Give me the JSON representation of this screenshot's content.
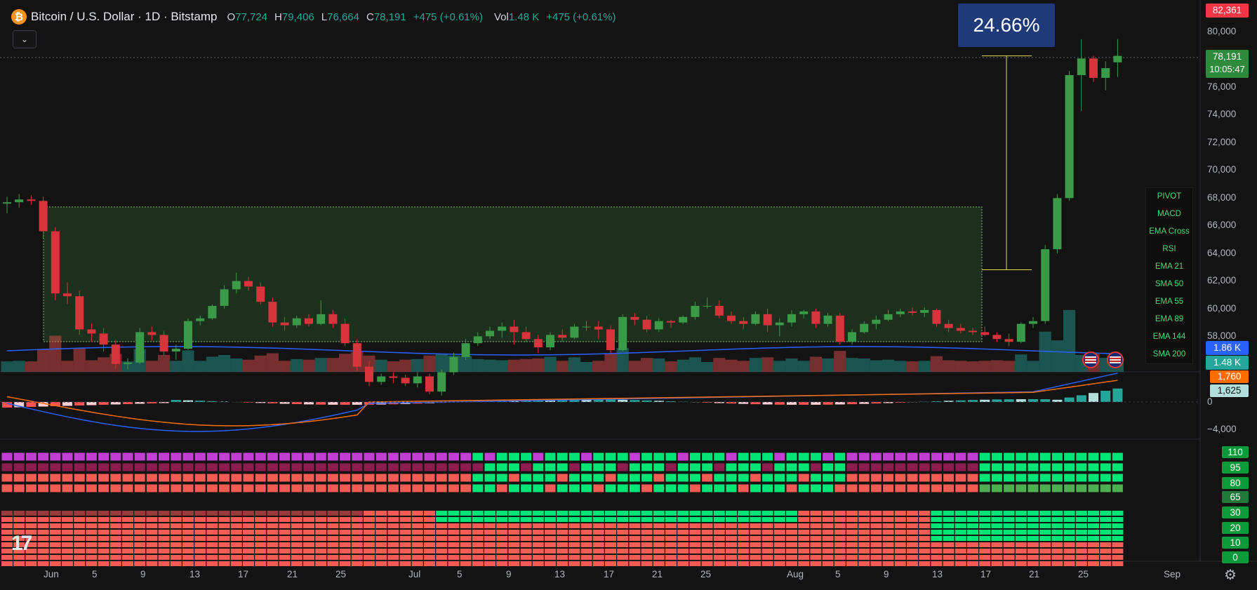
{
  "header": {
    "coin_symbol": "₿",
    "title": "Bitcoin / U.S. Dollar · 1D · Bitstamp",
    "ohlc": [
      {
        "k": "O",
        "v": "77,724"
      },
      {
        "k": "H",
        "v": "79,406"
      },
      {
        "k": "L",
        "v": "76,664"
      },
      {
        "k": "C",
        "v": "78,191"
      },
      {
        "k": "",
        "v": "+475 (+0.61%)"
      }
    ],
    "vol_label": "Vol",
    "vol_value": "1.48 K",
    "vol_change": "+475 (+0.61%)",
    "collapse_icon": "chevron-down-icon"
  },
  "measure": {
    "label": "24.66%"
  },
  "indicator_panel": [
    "PIVOT",
    "MACD",
    "EMA Cross",
    "RSI",
    "EMA 21",
    "SMA 50",
    "EMA 55",
    "EMA 89",
    "EMA 144",
    "SMA 200"
  ],
  "price_axis": {
    "ticks": [
      "80,000",
      "78,000",
      "76,000",
      "74,000",
      "72,000",
      "70,000",
      "68,000",
      "66,000",
      "64,000",
      "62,000",
      "60,000",
      "58,000"
    ],
    "high_tag": "82,361",
    "last_price": "78,191",
    "countdown": "10:05:47",
    "vol_ma_tag": "1.86 K",
    "vol_tag": "1.48 K"
  },
  "macd_axis": {
    "signal_tag": "1,760",
    "hist_tag": "1,625",
    "zero": "0",
    "low": "−4,000"
  },
  "rsi_axis": [
    "110",
    "95",
    "80",
    "65",
    "30",
    "20",
    "10",
    "0"
  ],
  "time_axis": [
    "Jun",
    "5",
    "9",
    "13",
    "17",
    "21",
    "25",
    "Jul",
    "5",
    "9",
    "13",
    "17",
    "21",
    "25",
    "Aug",
    "5",
    "9",
    "13",
    "17",
    "21",
    "25",
    "Sep"
  ],
  "logo": "17",
  "colors": {
    "up": "#26a69a",
    "candle_up": "#3a9a48",
    "down": "#d8343c",
    "accent_box": "#1e3a78",
    "green_tag": "#2e8b3c",
    "red_tag": "#f23645"
  },
  "chart_data": {
    "type": "candlestick",
    "title": "Bitcoin / U.S. Dollar · 1D · Bitstamp",
    "candles": [
      {
        "d": "2024-05-31",
        "o": 67500,
        "h": 68000,
        "l": 66800,
        "c": 67600
      },
      {
        "d": "2024-06-01",
        "o": 67600,
        "h": 68200,
        "l": 67200,
        "c": 67800
      },
      {
        "d": "2024-06-02",
        "o": 67800,
        "h": 68100,
        "l": 67400,
        "c": 67700
      },
      {
        "d": "2024-06-03",
        "o": 67700,
        "h": 68000,
        "l": 65000,
        "c": 65500
      },
      {
        "d": "2024-06-04",
        "o": 65500,
        "h": 65800,
        "l": 60500,
        "c": 61000
      },
      {
        "d": "2024-06-05",
        "o": 61000,
        "h": 61800,
        "l": 60200,
        "c": 60800
      },
      {
        "d": "2024-06-06",
        "o": 60800,
        "h": 61200,
        "l": 58000,
        "c": 58400
      },
      {
        "d": "2024-06-07",
        "o": 58400,
        "h": 58800,
        "l": 57500,
        "c": 58100
      },
      {
        "d": "2024-06-08",
        "o": 58100,
        "h": 58500,
        "l": 56800,
        "c": 57300
      },
      {
        "d": "2024-06-09",
        "o": 57300,
        "h": 57600,
        "l": 55600,
        "c": 55900
      },
      {
        "d": "2024-06-10",
        "o": 55900,
        "h": 56300,
        "l": 55500,
        "c": 56000
      },
      {
        "d": "2024-06-11",
        "o": 56000,
        "h": 58500,
        "l": 55900,
        "c": 58200
      },
      {
        "d": "2024-06-12",
        "o": 58200,
        "h": 58600,
        "l": 57600,
        "c": 58000
      },
      {
        "d": "2024-06-13",
        "o": 58000,
        "h": 58300,
        "l": 56500,
        "c": 56800
      },
      {
        "d": "2024-06-14",
        "o": 56800,
        "h": 57300,
        "l": 56200,
        "c": 57000
      },
      {
        "d": "2024-06-15",
        "o": 57000,
        "h": 59200,
        "l": 56900,
        "c": 59000
      },
      {
        "d": "2024-06-16",
        "o": 59000,
        "h": 59400,
        "l": 58700,
        "c": 59200
      },
      {
        "d": "2024-06-17",
        "o": 59200,
        "h": 60200,
        "l": 59100,
        "c": 60100
      },
      {
        "d": "2024-06-18",
        "o": 60100,
        "h": 61600,
        "l": 59900,
        "c": 61300
      },
      {
        "d": "2024-06-19",
        "o": 61300,
        "h": 62500,
        "l": 61000,
        "c": 61900
      },
      {
        "d": "2024-06-20",
        "o": 61900,
        "h": 62200,
        "l": 61200,
        "c": 61500
      },
      {
        "d": "2024-06-21",
        "o": 61500,
        "h": 61800,
        "l": 60200,
        "c": 60400
      },
      {
        "d": "2024-06-22",
        "o": 60400,
        "h": 60700,
        "l": 58600,
        "c": 58900
      },
      {
        "d": "2024-06-23",
        "o": 58900,
        "h": 59300,
        "l": 58300,
        "c": 58700
      },
      {
        "d": "2024-06-24",
        "o": 58700,
        "h": 59400,
        "l": 58500,
        "c": 59200
      },
      {
        "d": "2024-06-25",
        "o": 59200,
        "h": 59500,
        "l": 58600,
        "c": 58800
      },
      {
        "d": "2024-06-26",
        "o": 58800,
        "h": 60500,
        "l": 58700,
        "c": 59500
      },
      {
        "d": "2024-06-27",
        "o": 59500,
        "h": 59800,
        "l": 58500,
        "c": 58800
      },
      {
        "d": "2024-06-28",
        "o": 58800,
        "h": 59200,
        "l": 57200,
        "c": 57400
      },
      {
        "d": "2024-06-29",
        "o": 57400,
        "h": 57700,
        "l": 55400,
        "c": 55700
      },
      {
        "d": "2024-06-30",
        "o": 55700,
        "h": 56100,
        "l": 54300,
        "c": 54600
      },
      {
        "d": "2024-07-01",
        "o": 54600,
        "h": 55200,
        "l": 54400,
        "c": 55000
      },
      {
        "d": "2024-07-02",
        "o": 55000,
        "h": 55300,
        "l": 54500,
        "c": 54900
      },
      {
        "d": "2024-07-03",
        "o": 54900,
        "h": 55100,
        "l": 54300,
        "c": 54500
      },
      {
        "d": "2024-07-04",
        "o": 54500,
        "h": 55300,
        "l": 54200,
        "c": 55000
      },
      {
        "d": "2024-07-05",
        "o": 55000,
        "h": 55200,
        "l": 53700,
        "c": 53900
      },
      {
        "d": "2024-07-06",
        "o": 53900,
        "h": 55500,
        "l": 53600,
        "c": 55300
      },
      {
        "d": "2024-07-07",
        "o": 55300,
        "h": 56700,
        "l": 55100,
        "c": 56400
      },
      {
        "d": "2024-07-08",
        "o": 56400,
        "h": 57700,
        "l": 56200,
        "c": 57400
      },
      {
        "d": "2024-07-09",
        "o": 57400,
        "h": 58200,
        "l": 57200,
        "c": 57900
      },
      {
        "d": "2024-07-10",
        "o": 57900,
        "h": 58600,
        "l": 57700,
        "c": 58300
      },
      {
        "d": "2024-07-11",
        "o": 58300,
        "h": 58900,
        "l": 57800,
        "c": 58600
      },
      {
        "d": "2024-07-12",
        "o": 58600,
        "h": 59100,
        "l": 57300,
        "c": 58200
      },
      {
        "d": "2024-07-13",
        "o": 58200,
        "h": 58600,
        "l": 57500,
        "c": 57700
      },
      {
        "d": "2024-07-14",
        "o": 57700,
        "h": 58000,
        "l": 56700,
        "c": 57100
      },
      {
        "d": "2024-07-15",
        "o": 57100,
        "h": 58200,
        "l": 56900,
        "c": 58000
      },
      {
        "d": "2024-07-16",
        "o": 58000,
        "h": 58400,
        "l": 57500,
        "c": 57800
      },
      {
        "d": "2024-07-17",
        "o": 57800,
        "h": 58800,
        "l": 57700,
        "c": 58600
      },
      {
        "d": "2024-07-18",
        "o": 58600,
        "h": 59000,
        "l": 58300,
        "c": 58600
      },
      {
        "d": "2024-07-19",
        "o": 58600,
        "h": 59000,
        "l": 57700,
        "c": 58400
      },
      {
        "d": "2024-07-20",
        "o": 58400,
        "h": 58700,
        "l": 56600,
        "c": 56900
      },
      {
        "d": "2024-07-21",
        "o": 56900,
        "h": 59500,
        "l": 56800,
        "c": 59300
      },
      {
        "d": "2024-07-22",
        "o": 59300,
        "h": 59600,
        "l": 58700,
        "c": 59100
      },
      {
        "d": "2024-07-23",
        "o": 59100,
        "h": 59400,
        "l": 58200,
        "c": 58400
      },
      {
        "d": "2024-07-24",
        "o": 58400,
        "h": 59200,
        "l": 58200,
        "c": 59000
      },
      {
        "d": "2024-07-25",
        "o": 59000,
        "h": 59100,
        "l": 58500,
        "c": 58900
      },
      {
        "d": "2024-07-26",
        "o": 58900,
        "h": 59400,
        "l": 58800,
        "c": 59300
      },
      {
        "d": "2024-07-27",
        "o": 59300,
        "h": 60400,
        "l": 59100,
        "c": 60100
      },
      {
        "d": "2024-07-28",
        "o": 60100,
        "h": 60700,
        "l": 59900,
        "c": 60100
      },
      {
        "d": "2024-07-29",
        "o": 60100,
        "h": 60500,
        "l": 59200,
        "c": 59400
      },
      {
        "d": "2024-07-30",
        "o": 59400,
        "h": 59700,
        "l": 58800,
        "c": 59000
      },
      {
        "d": "2024-07-31",
        "o": 59000,
        "h": 59300,
        "l": 58400,
        "c": 58800
      },
      {
        "d": "2024-08-01",
        "o": 58800,
        "h": 59700,
        "l": 58700,
        "c": 59500
      },
      {
        "d": "2024-08-02",
        "o": 59500,
        "h": 59900,
        "l": 58200,
        "c": 58700
      },
      {
        "d": "2024-08-03",
        "o": 58700,
        "h": 59200,
        "l": 57900,
        "c": 58900
      },
      {
        "d": "2024-08-04",
        "o": 58900,
        "h": 59800,
        "l": 58600,
        "c": 59500
      },
      {
        "d": "2024-08-05",
        "o": 59500,
        "h": 59800,
        "l": 59200,
        "c": 59700
      },
      {
        "d": "2024-08-06",
        "o": 59700,
        "h": 59900,
        "l": 58500,
        "c": 58800
      },
      {
        "d": "2024-08-07",
        "o": 58800,
        "h": 59600,
        "l": 58600,
        "c": 59400
      },
      {
        "d": "2024-08-08",
        "o": 59400,
        "h": 59600,
        "l": 57300,
        "c": 57500
      },
      {
        "d": "2024-08-09",
        "o": 57500,
        "h": 58400,
        "l": 57300,
        "c": 58200
      },
      {
        "d": "2024-08-10",
        "o": 58200,
        "h": 59000,
        "l": 58100,
        "c": 58800
      },
      {
        "d": "2024-08-11",
        "o": 58800,
        "h": 59400,
        "l": 58400,
        "c": 59100
      },
      {
        "d": "2024-08-12",
        "o": 59100,
        "h": 59800,
        "l": 59000,
        "c": 59500
      },
      {
        "d": "2024-08-13",
        "o": 59500,
        "h": 59900,
        "l": 59300,
        "c": 59700
      },
      {
        "d": "2024-08-14",
        "o": 59700,
        "h": 60000,
        "l": 59400,
        "c": 59600
      },
      {
        "d": "2024-08-15",
        "o": 59600,
        "h": 60000,
        "l": 59300,
        "c": 59800
      },
      {
        "d": "2024-08-16",
        "o": 59800,
        "h": 59900,
        "l": 58600,
        "c": 58800
      },
      {
        "d": "2024-08-17",
        "o": 58800,
        "h": 59100,
        "l": 58200,
        "c": 58500
      },
      {
        "d": "2024-08-18",
        "o": 58500,
        "h": 58800,
        "l": 58100,
        "c": 58300
      },
      {
        "d": "2024-08-19",
        "o": 58300,
        "h": 58500,
        "l": 58000,
        "c": 58200
      },
      {
        "d": "2024-08-20",
        "o": 58200,
        "h": 58600,
        "l": 57900,
        "c": 58000
      },
      {
        "d": "2024-08-21",
        "o": 58000,
        "h": 58200,
        "l": 57500,
        "c": 57700
      },
      {
        "d": "2024-08-22",
        "o": 57700,
        "h": 58100,
        "l": 57200,
        "c": 57500
      },
      {
        "d": "2024-08-23",
        "o": 57500,
        "h": 58900,
        "l": 57400,
        "c": 58800
      },
      {
        "d": "2024-08-24",
        "o": 58800,
        "h": 59300,
        "l": 58500,
        "c": 59000
      },
      {
        "d": "2024-08-25",
        "o": 59000,
        "h": 64500,
        "l": 58800,
        "c": 64200
      },
      {
        "d": "2024-08-26",
        "o": 64200,
        "h": 68200,
        "l": 63900,
        "c": 67900
      },
      {
        "d": "2024-08-27",
        "o": 67900,
        "h": 77100,
        "l": 67700,
        "c": 76800
      },
      {
        "d": "2024-08-28",
        "o": 76800,
        "h": 79400,
        "l": 74200,
        "c": 78000
      },
      {
        "d": "2024-08-29",
        "o": 78000,
        "h": 78200,
        "l": 76300,
        "c": 76600
      },
      {
        "d": "2024-08-30",
        "o": 76600,
        "h": 77800,
        "l": 75700,
        "c": 77300
      },
      {
        "d": "2024-08-31",
        "o": 77724,
        "h": 79406,
        "l": 76664,
        "c": 78191
      }
    ],
    "ylim": [
      56000,
      81500
    ],
    "measure_range": {
      "from": 62718,
      "to": 78191,
      "pct": "24.66%"
    }
  }
}
